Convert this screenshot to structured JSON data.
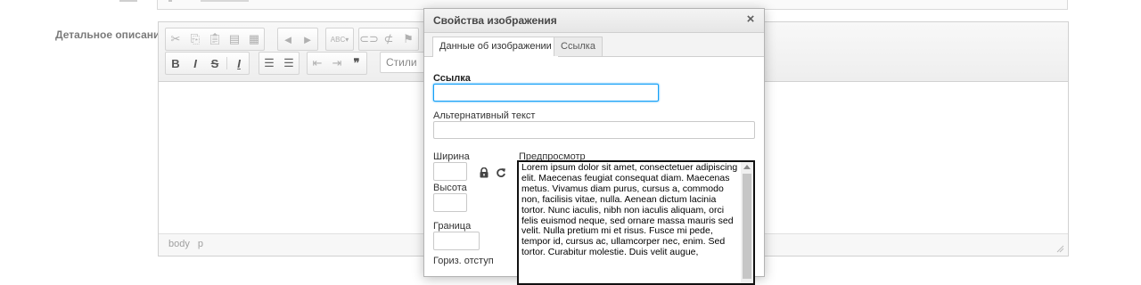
{
  "field": {
    "label": "Детальное описание"
  },
  "editor": {
    "toolbar": {
      "styles_label": "Стили"
    },
    "path": [
      "body",
      "p"
    ]
  },
  "dialog": {
    "title": "Свойства изображения",
    "close_symbol": "×",
    "tabs": [
      {
        "label": "Данные об изображении",
        "active": true
      },
      {
        "label": "Ссылка",
        "active": false
      }
    ],
    "url_label": "Ссылка",
    "url_value": "",
    "alt_label": "Альтернативный текст",
    "alt_value": "",
    "width_label": "Ширина",
    "height_label": "Высота",
    "border_label": "Граница",
    "hspace_label": "Гориз. отступ",
    "preview_label": "Предпросмотр",
    "preview_text": "Lorem ipsum dolor sit amet, consectetuer adipiscing elit. Maecenas feugiat consequat diam. Maecenas metus. Vivamus diam purus, cursus a, commodo non, facilisis vitae, nulla. Aenean dictum lacinia tortor. Nunc iaculis, nibh non iaculis aliquam, orci felis euismod neque, sed ornare massa mauris sed velit. Nulla pretium mi et risus. Fusce mi pede, tempor id, cursus ac, ullamcorper nec, enim. Sed tortor. Curabitur molestie. Duis velit augue,"
  },
  "colors": {
    "focus_border": "#139ff7",
    "label_gray": "#7a7a7a"
  }
}
